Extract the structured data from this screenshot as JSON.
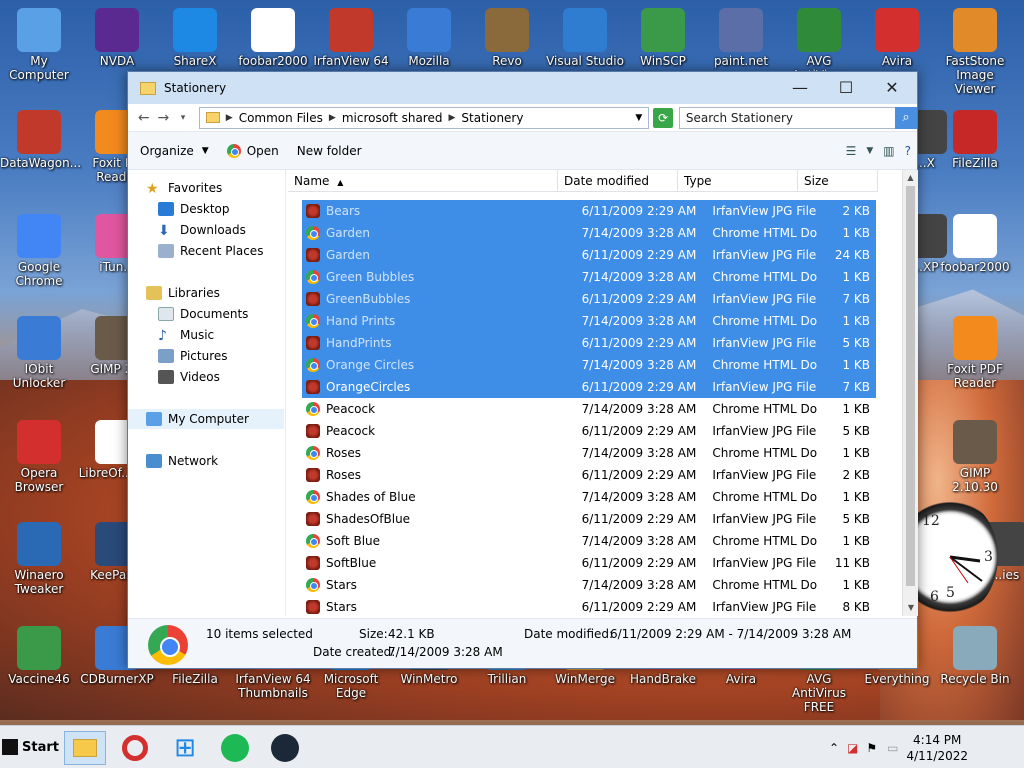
{
  "desktop": {
    "icons": [
      {
        "label": "My Computer",
        "color": "#5aa0e6"
      },
      {
        "label": "NVDA",
        "color": "#5b2a91"
      },
      {
        "label": "ShareX",
        "color": "#1e88e5"
      },
      {
        "label": "foobar2000",
        "color": "#ffffff"
      },
      {
        "label": "IrfanView 64",
        "color": "#c0392b"
      },
      {
        "label": "Mozilla",
        "color": "#3a7bd5"
      },
      {
        "label": "Revo",
        "color": "#8a6a3a"
      },
      {
        "label": "Visual Studio",
        "color": "#2f7dd1"
      },
      {
        "label": "WinSCP",
        "color": "#3a9a4a"
      },
      {
        "label": "paint.net",
        "color": "#5c6ea8"
      },
      {
        "label": "AVG AntiVirus",
        "color": "#2f8a3a"
      },
      {
        "label": "Avira",
        "color": "#d32f2f"
      },
      {
        "label": "FastStone Image Viewer",
        "color": "#e08a2a"
      },
      {
        "label": "DataWagon...",
        "color": "#c0392b"
      },
      {
        "label": "Foxit P... Read...",
        "color": "#f28a1e"
      },
      {
        "label": "FileZilla",
        "color": "#c62828"
      },
      {
        "label": "Google Chrome",
        "color": "#4285f4"
      },
      {
        "label": "iTun...",
        "color": "#e056a0"
      },
      {
        "label": "foobar2000",
        "color": "#ffffff"
      },
      {
        "label": "IObit Unlocker",
        "color": "#3a7bd5"
      },
      {
        "label": "GIMP 2...",
        "color": "#6a5a4a"
      },
      {
        "label": "Foxit PDF Reader",
        "color": "#f28a1e"
      },
      {
        "label": "Opera Browser",
        "color": "#d32f2f"
      },
      {
        "label": "LibreOf... 7.3",
        "color": "#ffffff"
      },
      {
        "label": "GIMP 2.10.30",
        "color": "#6a5a4a"
      },
      {
        "label": "Winaero Tweaker",
        "color": "#2a6ab5"
      },
      {
        "label": "KeePas...",
        "color": "#2a4a7a"
      },
      {
        "label": "Vaccine46",
        "color": "#3a9a4a"
      },
      {
        "label": "CDBurnerXP",
        "color": "#3a7bd5"
      },
      {
        "label": "FileZilla",
        "color": "#c62828"
      },
      {
        "label": "IrfanView 64 Thumbnails",
        "color": "#c0392b"
      },
      {
        "label": "Microsoft Edge",
        "color": "#1e88e5"
      },
      {
        "label": "WinMetro",
        "color": "#444"
      },
      {
        "label": "Trillian",
        "color": "#2a8ad5"
      },
      {
        "label": "WinMerge",
        "color": "#e0a020"
      },
      {
        "label": "HandBrake",
        "color": "#c0392b"
      },
      {
        "label": "Avira",
        "color": "#d32f2f"
      },
      {
        "label": "AVG AntiVirus FREE",
        "color": "#2f8a3a"
      },
      {
        "label": "Everything",
        "color": "#e07a1a"
      },
      {
        "label": "Recycle Bin",
        "color": "#8ab"
      },
      {
        "label": "...X",
        "color": "#444"
      },
      {
        "label": "...XP",
        "color": "#444"
      },
      {
        "label": "...ies",
        "color": "#444"
      }
    ]
  },
  "window": {
    "title": "Stationery",
    "minimize": "—",
    "maximize": "☐",
    "close": "✕",
    "address": {
      "segments": [
        "Common Files",
        "microsoft shared",
        "Stationery"
      ]
    },
    "search_placeholder": "Search Stationery",
    "toolbar": {
      "organize": "Organize",
      "open": "Open",
      "new_folder": "New folder"
    },
    "nav": {
      "favorites": "Favorites",
      "desktop": "Desktop",
      "downloads": "Downloads",
      "recent": "Recent Places",
      "libraries": "Libraries",
      "documents": "Documents",
      "music": "Music",
      "pictures": "Pictures",
      "videos": "Videos",
      "computer": "My Computer",
      "network": "Network"
    },
    "columns": {
      "name": "Name",
      "date": "Date modified",
      "type": "Type",
      "size": "Size"
    },
    "files": [
      {
        "name": "Bears",
        "date": "6/11/2009 2:29 AM",
        "type": "IrfanView JPG File",
        "size": "2 KB",
        "kind": "jpg",
        "selected": true
      },
      {
        "name": "Garden",
        "date": "7/14/2009 3:28 AM",
        "type": "Chrome HTML Do...",
        "size": "1 KB",
        "kind": "html",
        "selected": true
      },
      {
        "name": "Garden",
        "date": "6/11/2009 2:29 AM",
        "type": "IrfanView JPG File",
        "size": "24 KB",
        "kind": "jpg",
        "selected": true
      },
      {
        "name": "Green Bubbles",
        "date": "7/14/2009 3:28 AM",
        "type": "Chrome HTML Do...",
        "size": "1 KB",
        "kind": "html",
        "selected": true
      },
      {
        "name": "GreenBubbles",
        "date": "6/11/2009 2:29 AM",
        "type": "IrfanView JPG File",
        "size": "7 KB",
        "kind": "jpg",
        "selected": true
      },
      {
        "name": "Hand Prints",
        "date": "7/14/2009 3:28 AM",
        "type": "Chrome HTML Do...",
        "size": "1 KB",
        "kind": "html",
        "selected": true
      },
      {
        "name": "HandPrints",
        "date": "6/11/2009 2:29 AM",
        "type": "IrfanView JPG File",
        "size": "5 KB",
        "kind": "jpg",
        "selected": true
      },
      {
        "name": "Orange Circles",
        "date": "7/14/2009 3:28 AM",
        "type": "Chrome HTML Do...",
        "size": "1 KB",
        "kind": "html",
        "selected": true
      },
      {
        "name": "OrangeCircles",
        "date": "6/11/2009 2:29 AM",
        "type": "IrfanView JPG File",
        "size": "7 KB",
        "kind": "jpg",
        "selected": true
      },
      {
        "name": "Peacock",
        "date": "7/14/2009 3:28 AM",
        "type": "Chrome HTML Do...",
        "size": "1 KB",
        "kind": "html",
        "selected": false
      },
      {
        "name": "Peacock",
        "date": "6/11/2009 2:29 AM",
        "type": "IrfanView JPG File",
        "size": "5 KB",
        "kind": "jpg",
        "selected": false
      },
      {
        "name": "Roses",
        "date": "7/14/2009 3:28 AM",
        "type": "Chrome HTML Do...",
        "size": "1 KB",
        "kind": "html",
        "selected": false
      },
      {
        "name": "Roses",
        "date": "6/11/2009 2:29 AM",
        "type": "IrfanView JPG File",
        "size": "2 KB",
        "kind": "jpg",
        "selected": false
      },
      {
        "name": "Shades of Blue",
        "date": "7/14/2009 3:28 AM",
        "type": "Chrome HTML Do...",
        "size": "1 KB",
        "kind": "html",
        "selected": false
      },
      {
        "name": "ShadesOfBlue",
        "date": "6/11/2009 2:29 AM",
        "type": "IrfanView JPG File",
        "size": "5 KB",
        "kind": "jpg",
        "selected": false
      },
      {
        "name": "Soft Blue",
        "date": "7/14/2009 3:28 AM",
        "type": "Chrome HTML Do...",
        "size": "1 KB",
        "kind": "html",
        "selected": false
      },
      {
        "name": "SoftBlue",
        "date": "6/11/2009 2:29 AM",
        "type": "IrfanView JPG File",
        "size": "11 KB",
        "kind": "jpg",
        "selected": false
      },
      {
        "name": "Stars",
        "date": "7/14/2009 3:28 AM",
        "type": "Chrome HTML Do...",
        "size": "1 KB",
        "kind": "html",
        "selected": false
      },
      {
        "name": "Stars",
        "date": "6/11/2009 2:29 AM",
        "type": "IrfanView JPG File",
        "size": "8 KB",
        "kind": "jpg",
        "selected": false
      }
    ],
    "details": {
      "selected": "10 items selected",
      "size_label": "Size:",
      "size": "42.1 KB",
      "modified_label": "Date modified:",
      "modified": "6/11/2009 2:29 AM - 7/14/2009 3:28 AM",
      "created_label": "Date created:",
      "created": "7/14/2009 3:28 AM"
    }
  },
  "taskbar": {
    "start": "Start",
    "time": "4:14 PM",
    "date": "4/11/2022"
  }
}
